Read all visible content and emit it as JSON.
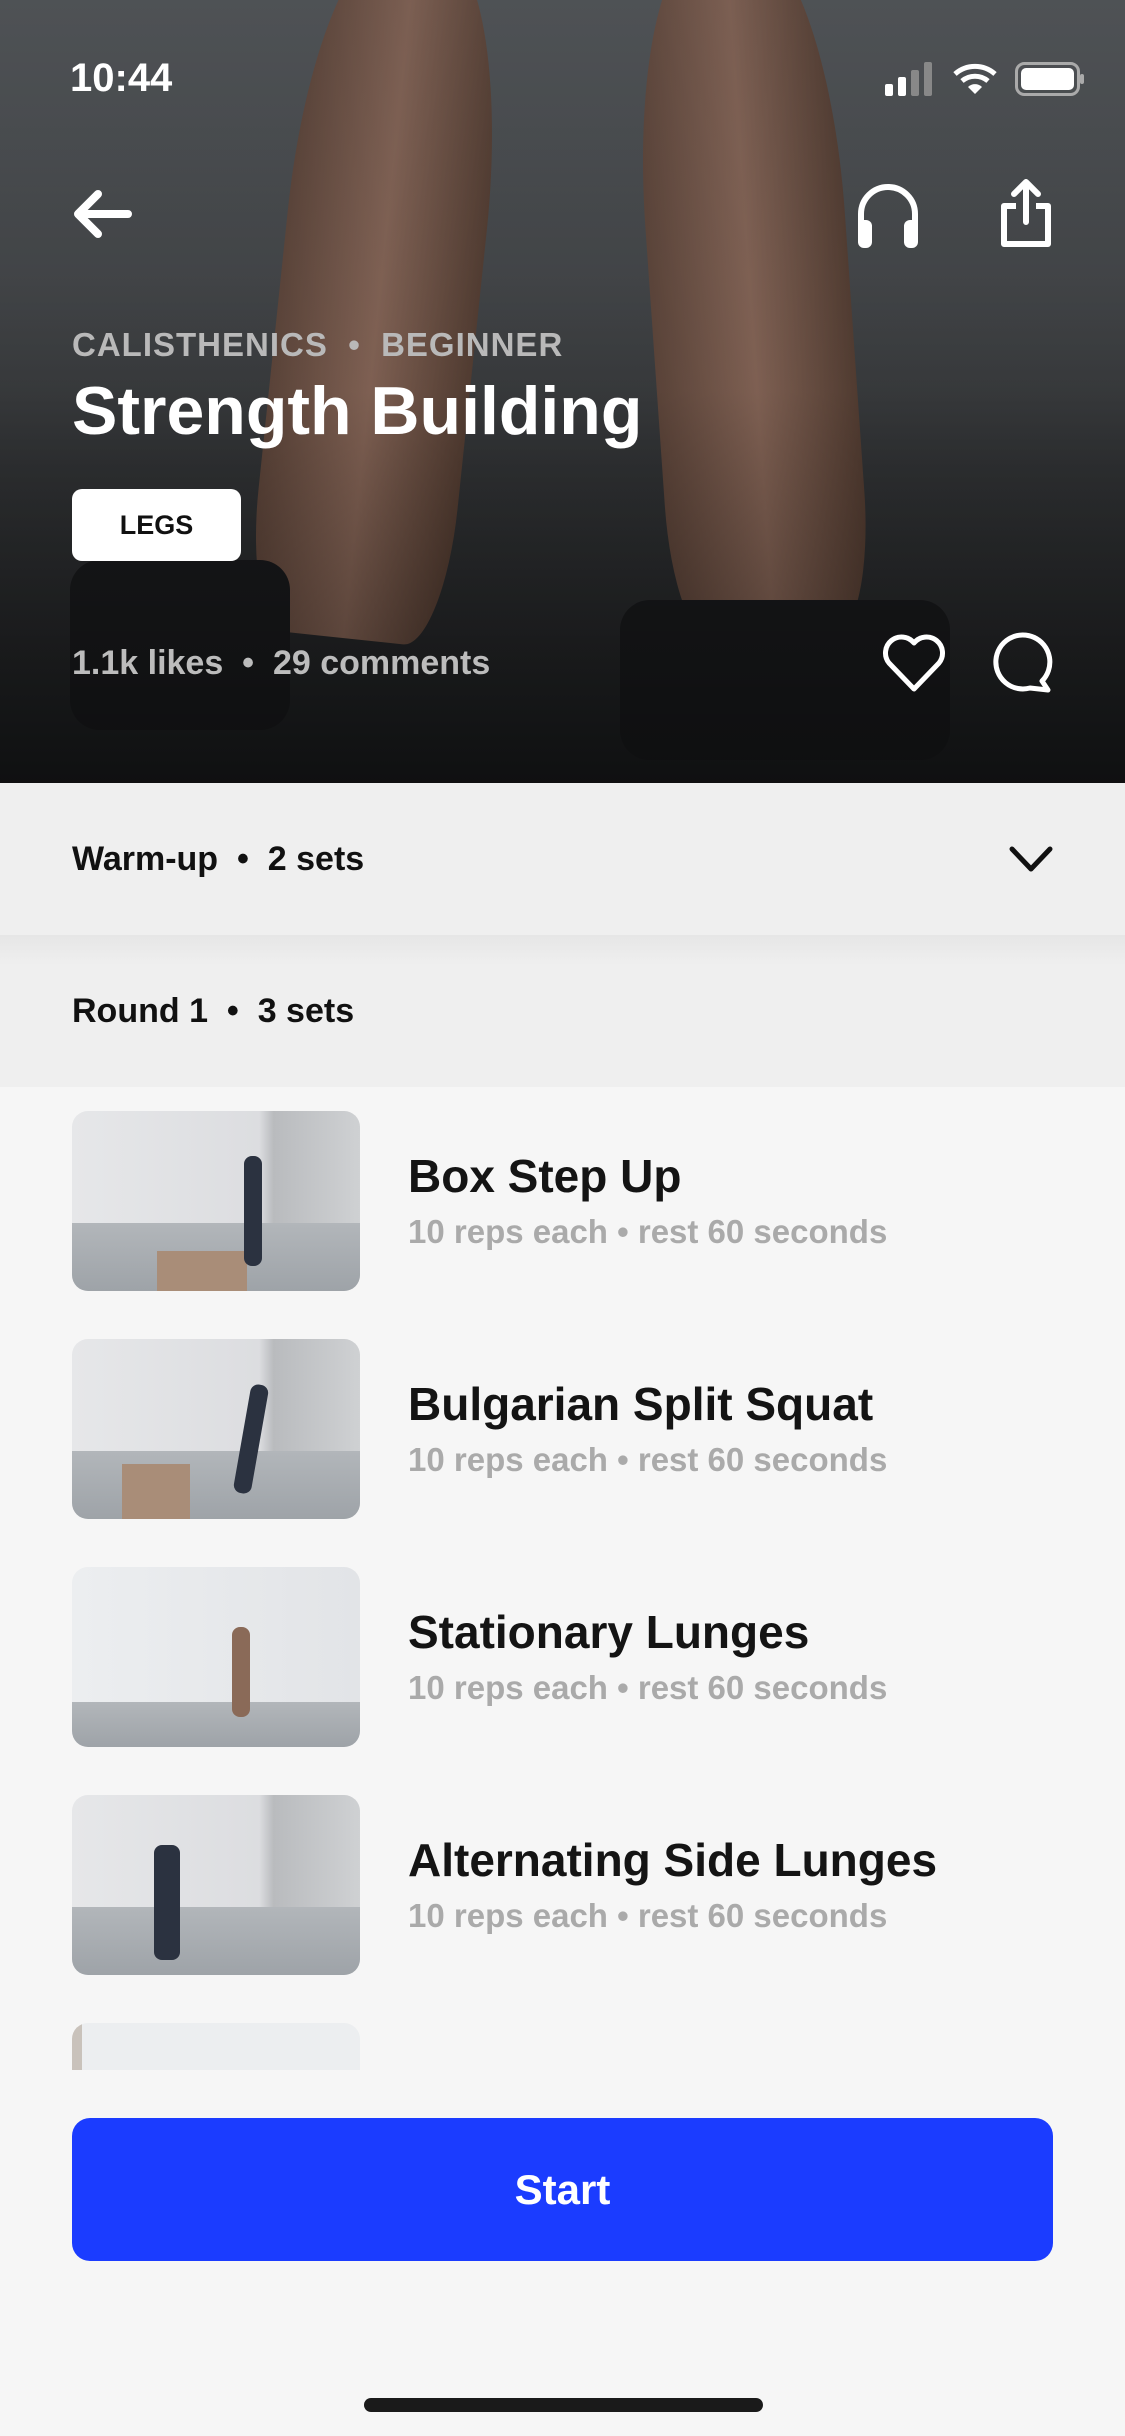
{
  "status_bar": {
    "time": "10:44"
  },
  "hero": {
    "category": "CALISTHENICS",
    "level": "BEGINNER",
    "separator": "•",
    "title": "Strength Building",
    "tag": "LEGS",
    "likes": "1.1k likes",
    "comments": "29 comments"
  },
  "sections": [
    {
      "label": "Warm-up",
      "sets": "2 sets",
      "state": "collapsed"
    },
    {
      "label": "Round 1",
      "sets": "3 sets"
    }
  ],
  "exercises": [
    {
      "name": "Box Step Up",
      "detail": "10 reps each • rest 60 seconds"
    },
    {
      "name": "Bulgarian Split Squat",
      "detail": "10 reps each • rest 60 seconds"
    },
    {
      "name": "Stationary Lunges",
      "detail": "10 reps each • rest 60 seconds"
    },
    {
      "name": "Alternating Side Lunges",
      "detail": "10 reps each • rest 60 seconds"
    }
  ],
  "start_label": "Start",
  "colors": {
    "accent": "#1b3cff"
  },
  "icons": [
    "back-arrow",
    "headphones",
    "share",
    "heart",
    "comment",
    "chevron-down"
  ]
}
